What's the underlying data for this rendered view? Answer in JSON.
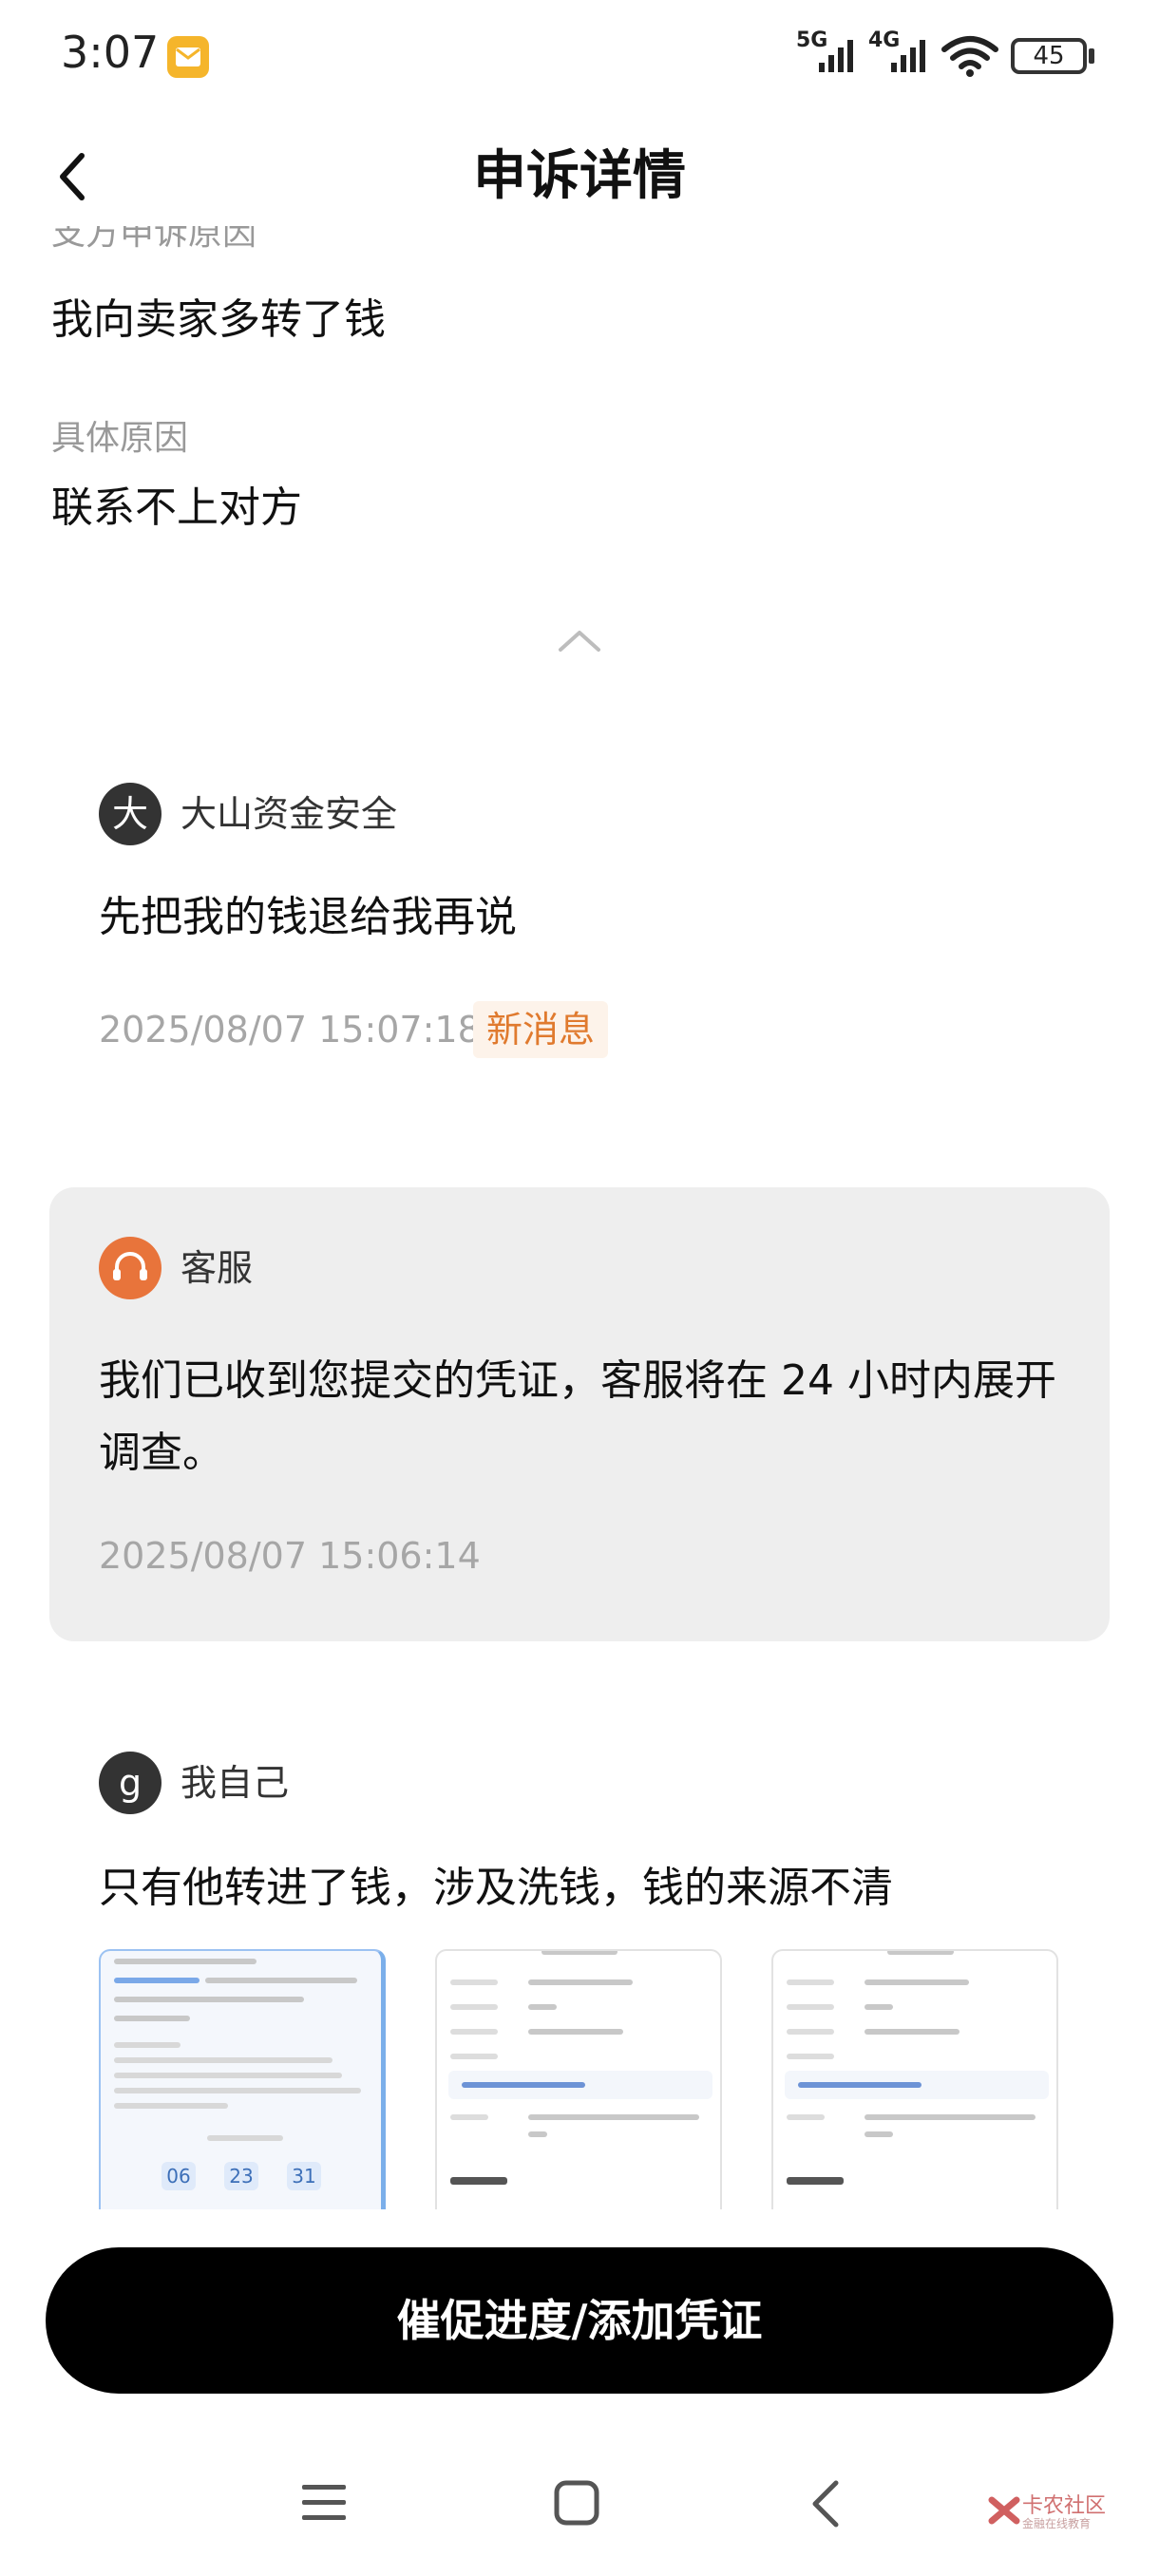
{
  "status_bar": {
    "time": "3:07",
    "signal_1_label": "5G",
    "signal_2_label": "4G",
    "battery": "45"
  },
  "header": {
    "title": "申诉详情"
  },
  "fields": {
    "clipped_label": "支方申诉原因",
    "reason_value": "我向卖家多转了钱",
    "detail_label": "具体原因",
    "detail_value": "联系不上对方"
  },
  "messages": [
    {
      "avatar_text": "大",
      "sender": "大山资金安全",
      "text": "先把我的钱退给我再说",
      "time": "2025/08/07 15:07:18",
      "badge": "新消息"
    },
    {
      "sender": "客服",
      "text": "我们已收到您提交的凭证，客服将在 24 小时内展开调查。",
      "time": "2025/08/07 15:06:14"
    },
    {
      "avatar_text": "g",
      "sender": "我自己",
      "text": "只有他转进了钱，涉及洗钱，钱的来源不清"
    }
  ],
  "thumbnails": [
    {
      "countdown": [
        "06",
        "23",
        "31"
      ]
    },
    {},
    {}
  ],
  "cta": {
    "label": "催促进度/添加凭证"
  },
  "watermark": {
    "text": "卡农社区",
    "sub": "金融在线教育"
  },
  "colors": {
    "cta_bg": "#000000",
    "badge_text": "#e07a2e",
    "service_avatar": "#e8743b",
    "card_bg": "#eeeeee"
  }
}
